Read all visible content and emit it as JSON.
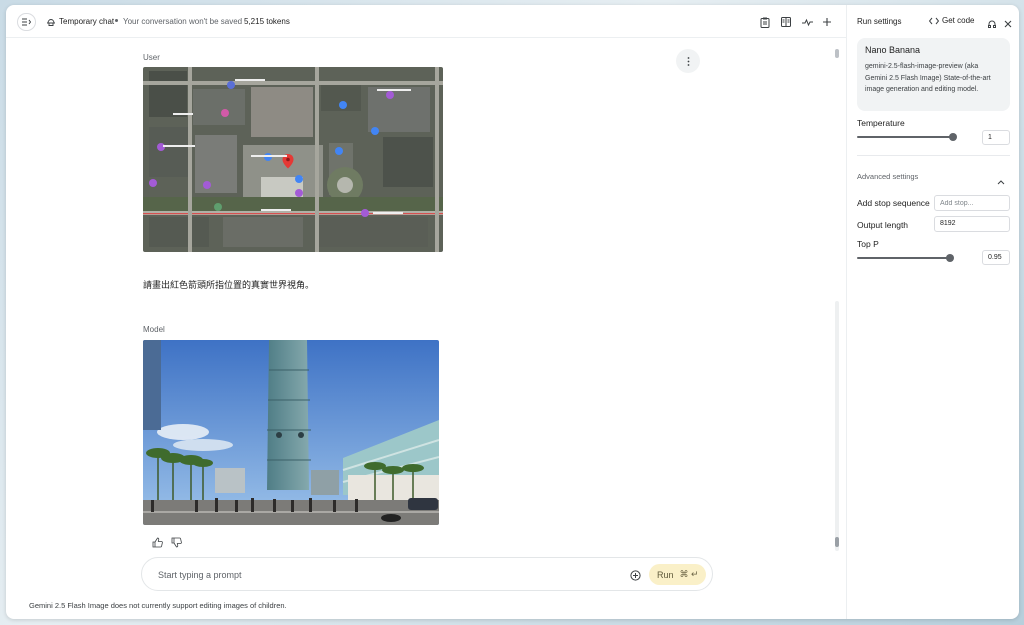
{
  "header": {
    "chat_mode": "Temporary chat",
    "chat_note": "Your conversation won't be saved",
    "tokens": "5,215 tokens"
  },
  "conversation": {
    "user_label": "User",
    "user_prompt": "請畫出紅色箭頭所指位置的真實世界視角。",
    "model_label": "Model"
  },
  "prompt": {
    "placeholder": "Start typing a prompt",
    "run_label": "Run",
    "run_shortcut": "⌘ ↵"
  },
  "footer": {
    "note": "Gemini 2.5 Flash Image does not currently support editing images of children."
  },
  "panel": {
    "title": "Run settings",
    "get_code": "Get code",
    "model": {
      "name": "Nano Banana",
      "description": "gemini-2.5-flash-image-preview (aka Gemini 2.5 Flash Image) State-of-the-art image generation and editing model."
    },
    "temperature": {
      "label": "Temperature",
      "value": "1",
      "fraction": 0.98
    },
    "advanced": {
      "label": "Advanced settings"
    },
    "stop_sequence": {
      "label": "Add stop sequence",
      "placeholder": "Add stop..."
    },
    "output_length": {
      "label": "Output length",
      "value": "8192"
    },
    "top_p": {
      "label": "Top P",
      "value": "0.95",
      "fraction": 0.95
    }
  },
  "colors": {
    "run_button_bg": "#faf0c8",
    "pin_red": "#e53935",
    "poi_purple": "#a35bd6",
    "poi_blue": "#4285f4"
  }
}
